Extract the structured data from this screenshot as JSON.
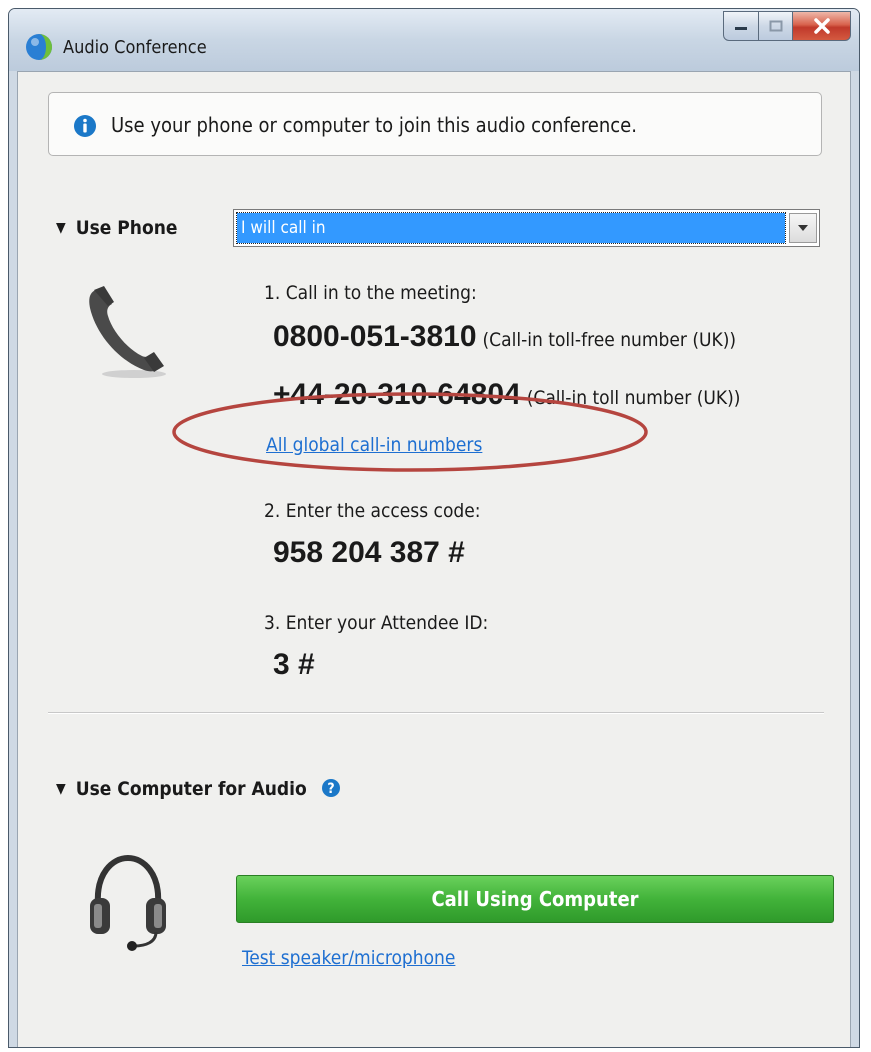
{
  "window": {
    "title": "Audio Conference",
    "controls": {
      "minimize": "minimize",
      "maximize": "maximize",
      "close": "close"
    }
  },
  "info": {
    "icon": "info-icon",
    "text": "Use your phone or computer to join this audio conference."
  },
  "phone_section": {
    "heading": "Use Phone",
    "dropdown_value": "I will call in",
    "step1": "1. Call in to the meeting:",
    "tollfree_number": "0800-051-3810",
    "tollfree_note": "(Call-in toll-free number (UK))",
    "toll_number": "+44-20-310-64804",
    "toll_note": "(Call-in toll number (UK))",
    "global_link": "All global call-in numbers",
    "step2": "2. Enter the access code:",
    "access_code": "958 204 387 #",
    "step3": "3. Enter your Attendee ID:",
    "attendee_id": "3 #"
  },
  "computer_section": {
    "heading": "Use Computer for Audio",
    "call_button": "Call Using Computer",
    "test_link": "Test speaker/microphone"
  },
  "colors": {
    "link": "#1e6fd1",
    "call_button": "#42b33a",
    "dropdown_selection": "#3399ff",
    "annotation": "#b5453f"
  }
}
